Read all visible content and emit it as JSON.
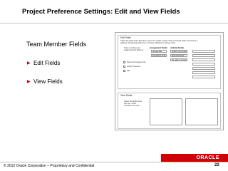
{
  "slide": {
    "title": "Project Preference Settings: Edit and View Fields",
    "heading": "Team Member Fields",
    "bullets": [
      "Edit Fields",
      "View Fields"
    ],
    "footer": "© 2012 Oracle Corporation – Proprietary and Confidential",
    "page_number": "22",
    "brand": "ORACLE",
    "accent_color": "#d20000"
  },
  "screenshot": {
    "edit_panel": {
      "title": "Edit Fields",
      "description": "Select the fields Team Members users can update. Assign Task and Assign Task and choose a address. Remaining fields from a choose indicates for assign entity.",
      "left_label": "Team members can assign/ specify fields as",
      "col_assignment": "Assignment Fields",
      "col_activity": "Activity Fields",
      "assignment_values": [
        "Actual Units",
        "Remaining Units"
      ],
      "activity_values": [
        "Activity % Complete",
        "Expected Finish"
      ],
      "extra_values": [
        "Remaining Duration"
      ],
      "checkboxes": [
        "Resource Assignments",
        "Activity Scenario",
        "Edit"
      ]
    },
    "view_panel": {
      "title": "View Fields",
      "left_label": "Select the fields users can see / team members can view"
    }
  }
}
